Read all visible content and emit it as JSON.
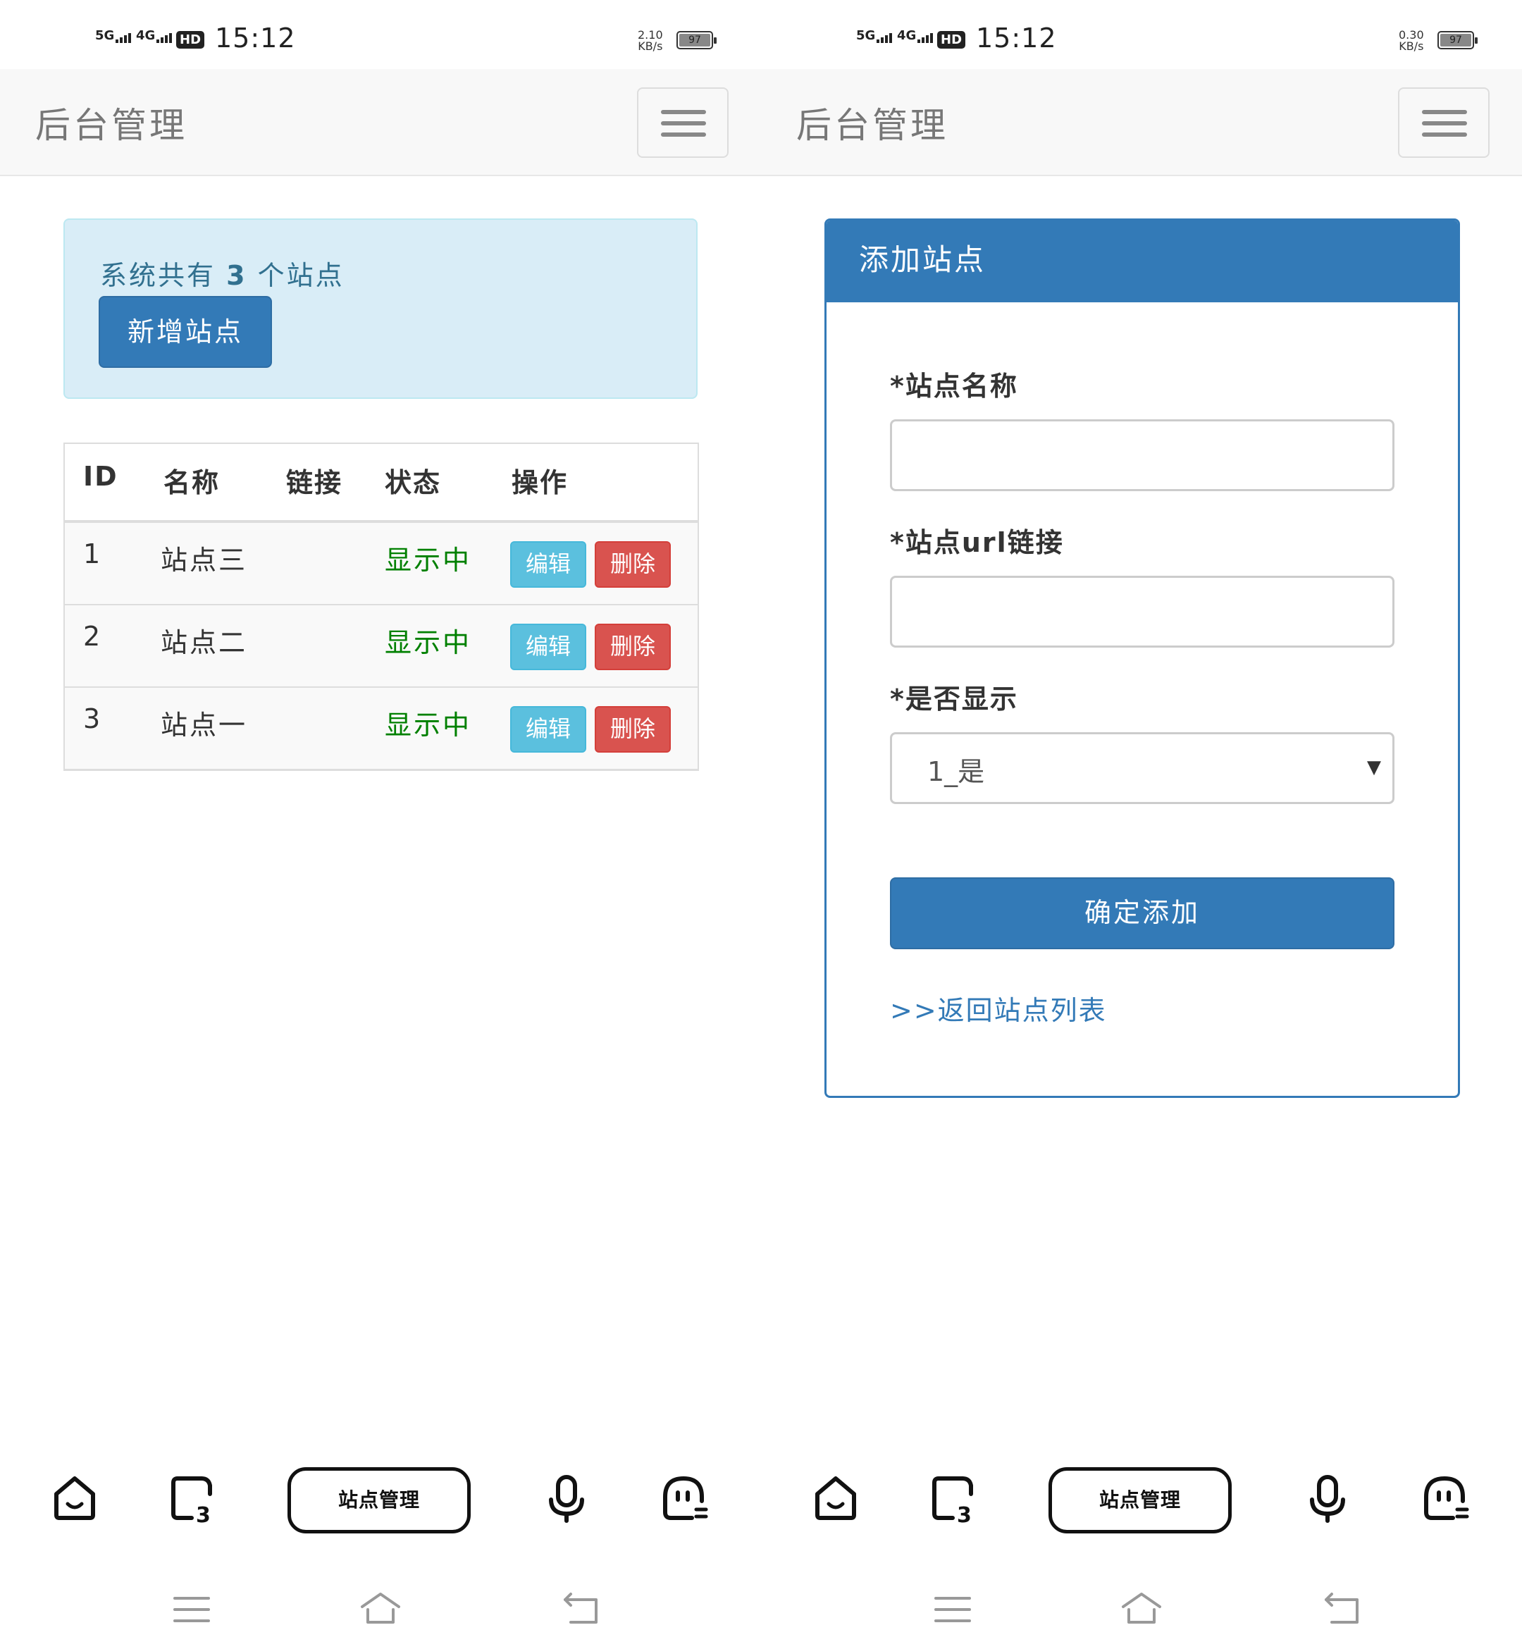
{
  "status_bar": {
    "sig1": "5G",
    "sig2": "4G",
    "hd": "HD",
    "time": "15:12",
    "left_speed": "2.10",
    "right_speed": "0.30",
    "speed_unit": "KB/s",
    "battery": "97"
  },
  "navbar": {
    "brand": "后台管理"
  },
  "list_page": {
    "alert_prefix": "系统共有",
    "site_count": "3",
    "alert_suffix": "个站点",
    "new_button": "新增站点",
    "columns": [
      "ID",
      "名称",
      "链接",
      "状态",
      "操作"
    ],
    "rows": [
      {
        "id": "1",
        "name": "站点三",
        "link": "",
        "status": "显示中",
        "edit": "编辑",
        "delete": "删除"
      },
      {
        "id": "2",
        "name": "站点二",
        "link": "",
        "status": "显示中",
        "edit": "编辑",
        "delete": "删除"
      },
      {
        "id": "3",
        "name": "站点一",
        "link": "",
        "status": "显示中",
        "edit": "编辑",
        "delete": "删除"
      }
    ]
  },
  "add_page": {
    "panel_title": "添加站点",
    "name_label": "*站点名称",
    "name_value": "",
    "url_label": "*站点url链接",
    "url_value": "",
    "show_label": "*是否显示",
    "show_value": "1_是",
    "caret": "▼",
    "submit": "确定添加",
    "back_link": ">>返回站点列表"
  },
  "bottom_bar": {
    "pill_label": "站点管理",
    "tabs_badge": "3",
    "icons": [
      "home-icon",
      "tabs-icon",
      "microphone-icon",
      "assistant-icon"
    ]
  },
  "system_nav": {
    "icons": [
      "menu-icon",
      "home-icon",
      "back-icon"
    ]
  },
  "colors": {
    "primary": "#337ab7",
    "info": "#5bc0de",
    "danger": "#d9534f",
    "success_text": "#008000",
    "alert_bg": "#d9edf7"
  }
}
